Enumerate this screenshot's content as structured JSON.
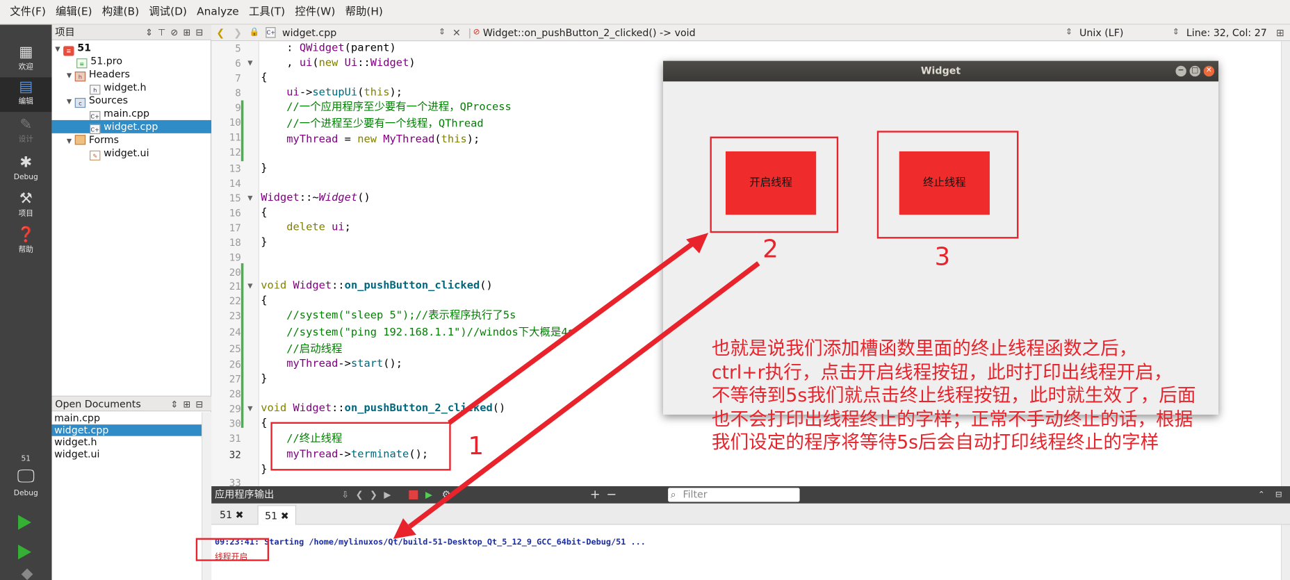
{
  "menu": [
    "文件(F)",
    "编辑(E)",
    "构建(B)",
    "调试(D)",
    "Analyze",
    "工具(T)",
    "控件(W)",
    "帮助(H)"
  ],
  "modes": {
    "welcome": "欢迎",
    "edit": "编辑",
    "design": "设计",
    "debug": "Debug",
    "projects": "项目",
    "help": "帮助",
    "kit_name": "51",
    "kit_mode": "Debug"
  },
  "projects_pane": {
    "title": "项目",
    "root": "51",
    "pro_file": "51.pro",
    "headers": "Headers",
    "header_file": "widget.h",
    "sources": "Sources",
    "main_file": "main.cpp",
    "widget_file": "widget.cpp",
    "forms": "Forms",
    "ui_file": "widget.ui"
  },
  "open_docs": {
    "title": "Open Documents",
    "items": [
      "main.cpp",
      "widget.cpp",
      "widget.h",
      "widget.ui"
    ]
  },
  "editor": {
    "file": "widget.cpp",
    "symbol": "Widget::on_pushButton_2_clicked() -> void",
    "line_ending": "Unix (LF)",
    "position": "Line: 32, Col: 27",
    "line_numbers": [
      "5",
      "6",
      "7",
      "8",
      "9",
      "10",
      "11",
      "12",
      "13",
      "14",
      "15",
      "16",
      "17",
      "18",
      "19",
      "20",
      "21",
      "22",
      "23",
      "24",
      "25",
      "26",
      "27",
      "28",
      "29",
      "30",
      "31",
      "32",
      "33"
    ],
    "code": {
      "l5a": "    : ",
      "l5b": "QWidget",
      "l5c": "(parent)",
      "l6a": "    , ",
      "l6b": "ui",
      "l6c": "(",
      "l6d": "new",
      "l6e": " ",
      "l6f": "Ui",
      "l6g": "::",
      "l6h": "Widget",
      "l6i": ")",
      "l7": "{",
      "l8a": "    ",
      "l8b": "ui",
      "l8c": "->",
      "l8d": "setupUi",
      "l8e": "(",
      "l8f": "this",
      "l8g": ");",
      "l9": "    //一个应用程序至少要有一个进程，QProcess",
      "l10": "    //一个进程至少要有一个线程，QThread",
      "l11a": "    ",
      "l11b": "myThread",
      "l11c": " = ",
      "l11d": "new",
      "l11e": " ",
      "l11f": "MyThread",
      "l11g": "(",
      "l11h": "this",
      "l11i": ");",
      "l13": "}",
      "l15a": "Widget",
      "l15b": "::~",
      "l15c": "Widget",
      "l15d": "()",
      "l16": "{",
      "l17a": "    ",
      "l17b": "delete",
      "l17c": " ",
      "l17d": "ui",
      "l17e": ";",
      "l18": "}",
      "l21a": "void",
      "l21b": " ",
      "l21c": "Widget",
      "l21d": "::",
      "l21e": "on_pushButton_clicked",
      "l21f": "()",
      "l22": "{",
      "l23": "    //system(\"sleep 5\");//表示程序执行了5s",
      "l24": "    //system(\"ping 192.168.1.1\")//windos下大概是4s",
      "l25": "    //启动线程",
      "l26a": "    ",
      "l26b": "myThread",
      "l26c": "->",
      "l26d": "start",
      "l26e": "();",
      "l27": "}",
      "l29a": "void",
      "l29b": " ",
      "l29c": "Widget",
      "l29d": "::",
      "l29e": "on_pushButton_2_clicked",
      "l29f": "()",
      "l30": "{",
      "l31": "    //终止线程",
      "l32a": "    ",
      "l32b": "myThread",
      "l32c": "->",
      "l32d": "terminate",
      "l32e": "();",
      "l33": "}"
    }
  },
  "output": {
    "title": "应用程序输出",
    "filter_placeholder": "Filter",
    "tabs": [
      "51",
      "51"
    ],
    "line1": "09:23:41: Starting /home/mylinuxos/Qt/build-51-Desktop_Qt_5_12_9_GCC_64bit-Debug/51 ...",
    "line2": "线程开启"
  },
  "app_window": {
    "title": "Widget",
    "start_button": "开启线程",
    "stop_button": "终止线程"
  },
  "annotations": {
    "n1": "1",
    "n2": "2",
    "n3": "3",
    "note": [
      "也就是说我们添加槽函数里面的终止线程函数之后，",
      "ctrl+r执行，点击开启线程按钮，此时打印出线程开启，",
      "不等待到5s我们就点击终止线程按钮，此时就生效了，后面",
      "也不会打印出线程终止的字样；正常不手动终止的话，根据",
      "我们设定的程序将等待5s后会自动打印线程终止的字样"
    ]
  },
  "colors": {
    "annotation": "#e8232b",
    "selection": "#308cc6",
    "modebar": "#414141",
    "button": "#f02b2b"
  }
}
